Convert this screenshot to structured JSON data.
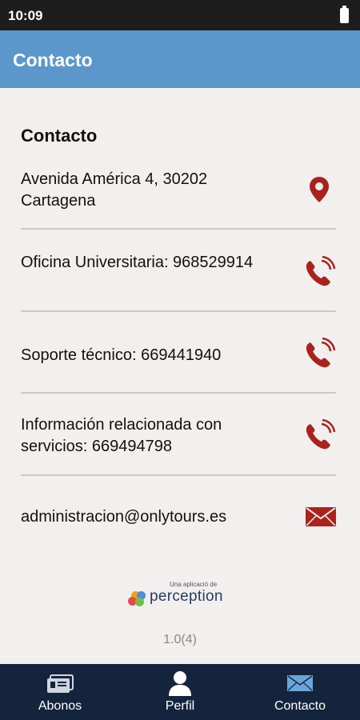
{
  "status_bar": {
    "time": "10:09"
  },
  "header": {
    "title": "Contacto"
  },
  "main": {
    "section_title": "Contacto",
    "rows": [
      {
        "text": "Avenida América 4, 30202 Cartagena",
        "icon": "location-pin-icon"
      },
      {
        "text": "Oficina Universitaria: 968529914",
        "icon": "phone-icon"
      },
      {
        "text": "Soporte técnico: 669441940",
        "icon": "phone-icon"
      },
      {
        "text": "Información relacionada con servicios: 669494798",
        "icon": "phone-icon"
      },
      {
        "text": "administracion@onlytours.es",
        "icon": "mail-icon"
      }
    ],
    "branding": {
      "tagline": "Una aplicació de",
      "name": "perception"
    },
    "version": "1.0(4)"
  },
  "bottom_nav": {
    "items": [
      {
        "label": "Abonos",
        "icon": "ticket-icon"
      },
      {
        "label": "Perfil",
        "icon": "person-icon"
      },
      {
        "label": "Contacto",
        "icon": "envelope-icon"
      }
    ]
  },
  "colors": {
    "app_bar": "#5c97cc",
    "accent_icon": "#a9231c",
    "bottom_nav": "#15243d",
    "nav_active_icon": "#6aa6dc"
  }
}
